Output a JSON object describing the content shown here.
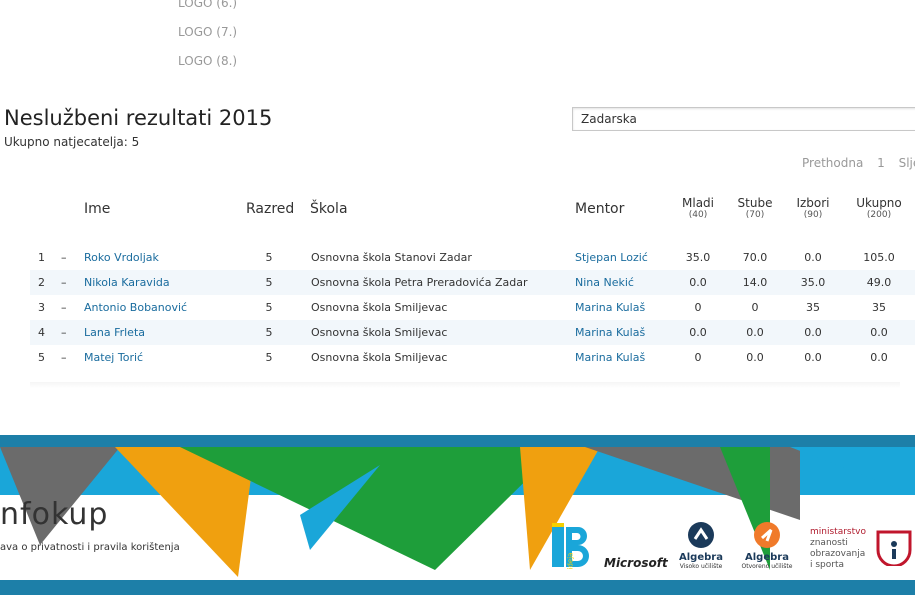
{
  "logos": [
    "LOGO (6.)",
    "LOGO (7.)",
    "LOGO (8.)"
  ],
  "title": "Neslužbeni rezultati 2015",
  "participants_label": "Ukupno natjecatelja: 5",
  "search_value": "Zadarska",
  "pager": {
    "prev": "Prethodna",
    "page": "1",
    "next": "Sljed"
  },
  "headers": {
    "name": "Ime",
    "grade": "Razred",
    "school": "Škola",
    "mentor": "Mentor",
    "mladi": "Mladi",
    "mladi_max": "(40)",
    "stube": "Stube",
    "stube_max": "(70)",
    "izbori": "Izbori",
    "izbori_max": "(90)",
    "ukupno": "Ukupno",
    "ukupno_max": "(200)"
  },
  "rows": [
    {
      "rank": "1",
      "dash": "–",
      "name": "Roko Vrdoljak",
      "grade": "5",
      "school": "Osnovna škola Stanovi Zadar",
      "mentor": "Stjepan Lozić",
      "mladi": "35.0",
      "stube": "70.0",
      "izbori": "0.0",
      "ukupno": "105.0"
    },
    {
      "rank": "2",
      "dash": "–",
      "name": "Nikola Karavida",
      "grade": "5",
      "school": "Osnovna škola Petra Preradovića Zadar",
      "mentor": "Nina Nekić",
      "mladi": "0.0",
      "stube": "14.0",
      "izbori": "35.0",
      "ukupno": "49.0"
    },
    {
      "rank": "3",
      "dash": "–",
      "name": "Antonio Bobanović",
      "grade": "5",
      "school": "Osnovna škola Smiljevac",
      "mentor": "Marina Kulaš",
      "mladi": "0",
      "stube": "0",
      "izbori": "35",
      "ukupno": "35"
    },
    {
      "rank": "4",
      "dash": "–",
      "name": "Lana Frleta",
      "grade": "5",
      "school": "Osnovna škola Smiljevac",
      "mentor": "Marina Kulaš",
      "mladi": "0.0",
      "stube": "0.0",
      "izbori": "0.0",
      "ukupno": "0.0"
    },
    {
      "rank": "5",
      "dash": "–",
      "name": "Matej Torić",
      "grade": "5",
      "school": "Osnovna škola Smiljevac",
      "mentor": "Marina Kulaš",
      "mladi": "0",
      "stube": "0.0",
      "izbori": "0.0",
      "ukupno": "0.0"
    }
  ],
  "footer": {
    "brand_a": "nfo",
    "brand_b": "kup",
    "privacy": "ava o privatnosti i pravila korištenja",
    "ideja": "ideja",
    "microsoft": "Microsoft",
    "algebra1": "Algebra",
    "algebra1_sub": "Visoko učilište",
    "algebra2": "Algebra",
    "algebra2_sub": "Otvoreno učilište",
    "mzo": [
      "ministarstvo",
      "znanosti",
      "obrazovanja",
      "i sporta"
    ]
  },
  "colors": {
    "link": "#1a6c9e",
    "stripe": "#1d7fa8",
    "orange": "#f0a00f",
    "green": "#1e9e3a",
    "gray": "#6b6b6b",
    "sky": "#1aa6d9"
  }
}
